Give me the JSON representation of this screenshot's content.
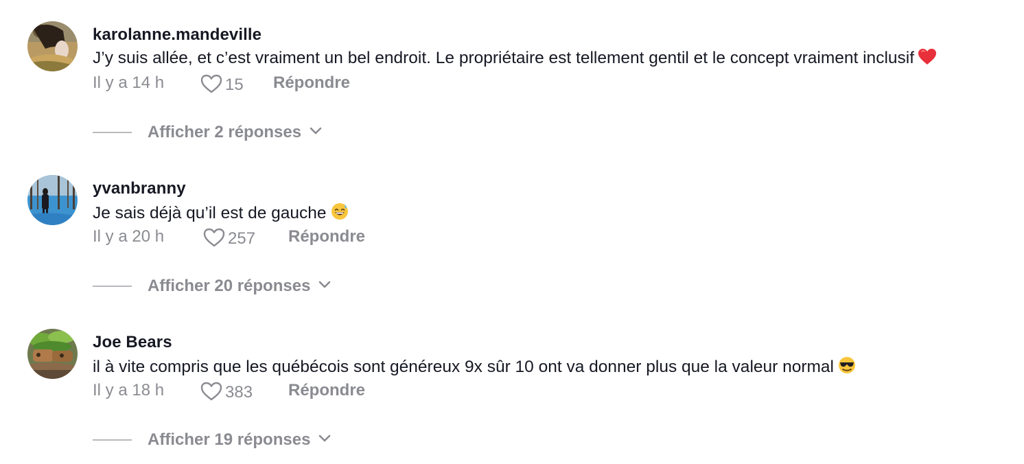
{
  "comments": [
    {
      "username": "karolanne.mandeville",
      "text": "J’y suis allée, et c’est vraiment un bel endroit. Le propriétaire est tellement gentil et le concept vraiment inclusif",
      "emoji": "red-heart-emoji",
      "time": "Il y a 14 h",
      "likes": "15",
      "reply_label": "Répondre",
      "view_replies": "Afficher 2 réponses"
    },
    {
      "username": "yvanbranny",
      "text": "Je sais déjà qu’il est de gauche",
      "emoji": "grinning-sweat-emoji",
      "time": "Il y a 20 h",
      "likes": "257",
      "reply_label": "Répondre",
      "view_replies": "Afficher 20 réponses"
    },
    {
      "username": "Joe Bears",
      "text": "il à vite compris que les québécois sont généreux 9x sûr 10 ont va donner plus que la valeur normal",
      "emoji": "sunglasses-face-emoji",
      "time": "Il y a 18 h",
      "likes": "383",
      "reply_label": "Répondre",
      "view_replies": "Afficher 19 réponses"
    }
  ],
  "colors": {
    "primary_text": "#161823",
    "secondary_text": "#8a8b91",
    "divider": "#b8b9bd"
  }
}
